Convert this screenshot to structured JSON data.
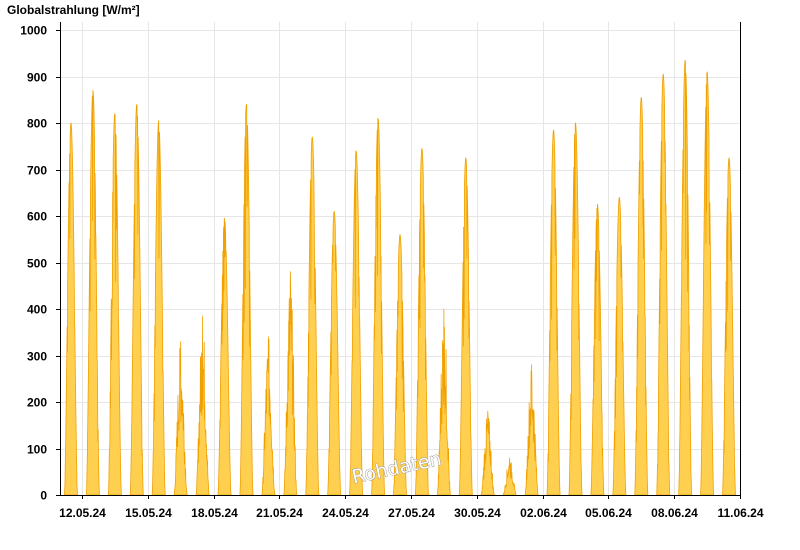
{
  "chart_data": {
    "type": "area",
    "ylabel": "Globalstrahlung [W/m²]",
    "ylim": [
      0,
      1000
    ],
    "yticks": [
      0,
      100,
      200,
      300,
      400,
      500,
      600,
      700,
      800,
      900,
      1000
    ],
    "x_start": "11.05.24",
    "x_end": "11.06.24",
    "xticks": [
      "12.05.24",
      "15.05.24",
      "18.05.24",
      "21.05.24",
      "24.05.24",
      "27.05.24",
      "30.05.24",
      "02.06.24",
      "05.06.24",
      "08.06.24",
      "11.06.24"
    ],
    "grid": true,
    "watermark": "Rohdaten",
    "colors": {
      "fill": "#ffd050",
      "line": "#f0a000",
      "grid": "#e6e6e6",
      "axis": "#000000"
    },
    "series": [
      {
        "daily_peaks": [
          {
            "date": "11.05.24",
            "max": 800
          },
          {
            "date": "12.05.24",
            "max": 870
          },
          {
            "date": "13.05.24",
            "max": 820
          },
          {
            "date": "14.05.24",
            "max": 840
          },
          {
            "date": "15.05.24",
            "max": 805
          },
          {
            "date": "16.05.24",
            "max": 330
          },
          {
            "date": "17.05.24",
            "max": 385
          },
          {
            "date": "18.05.24",
            "max": 595
          },
          {
            "date": "19.05.24",
            "max": 840
          },
          {
            "date": "20.05.24",
            "max": 340
          },
          {
            "date": "21.05.24",
            "max": 480
          },
          {
            "date": "22.05.24",
            "max": 770
          },
          {
            "date": "23.05.24",
            "max": 610
          },
          {
            "date": "24.05.24",
            "max": 740
          },
          {
            "date": "25.05.24",
            "max": 810
          },
          {
            "date": "26.05.24",
            "max": 560
          },
          {
            "date": "27.05.24",
            "max": 745
          },
          {
            "date": "28.05.24",
            "max": 400
          },
          {
            "date": "29.05.24",
            "max": 725
          },
          {
            "date": "30.05.24",
            "max": 180
          },
          {
            "date": "31.05.24",
            "max": 80
          },
          {
            "date": "01.06.24",
            "max": 280
          },
          {
            "date": "02.06.24",
            "max": 785
          },
          {
            "date": "03.06.24",
            "max": 800
          },
          {
            "date": "04.06.24",
            "max": 625
          },
          {
            "date": "05.06.24",
            "max": 640
          },
          {
            "date": "06.06.24",
            "max": 855
          },
          {
            "date": "07.06.24",
            "max": 905
          },
          {
            "date": "08.06.24",
            "max": 935
          },
          {
            "date": "09.06.24",
            "max": 910
          },
          {
            "date": "10.06.24",
            "max": 725
          }
        ]
      }
    ]
  }
}
